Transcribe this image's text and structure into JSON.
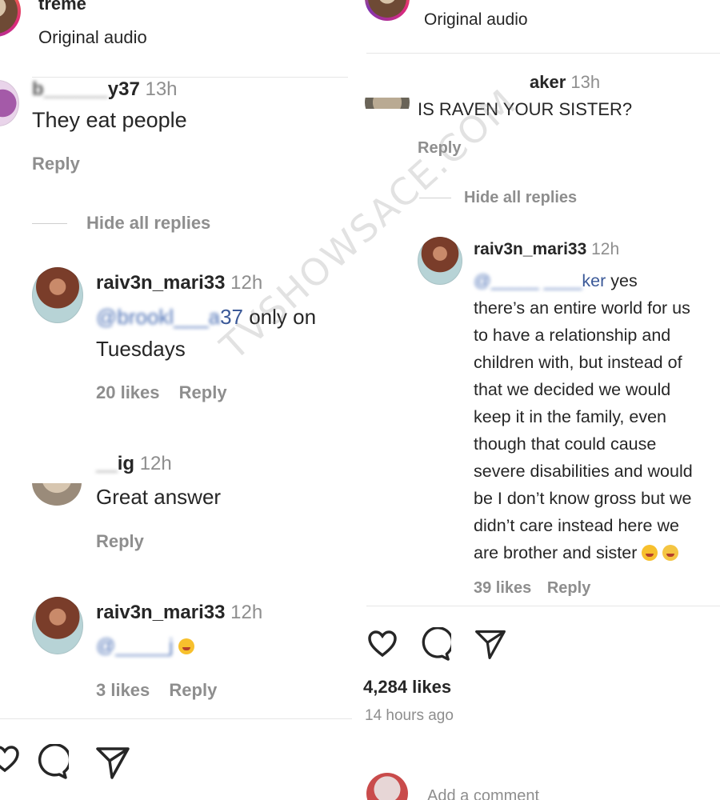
{
  "left": {
    "top_username_fragment": "treme",
    "top_audio": "Original audio",
    "comment1": {
      "username_visible": "y37",
      "time": "13h",
      "text": "They eat people",
      "reply": "Reply"
    },
    "hide_replies": "Hide all replies",
    "reply1": {
      "username": "raiv3n_mari33",
      "time": "12h",
      "mention_visible": "37",
      "text_inline": "only on",
      "text_line2": "Tuesdays",
      "likes": "20 likes",
      "reply": "Reply"
    },
    "reply2": {
      "username_visible": "ig",
      "time": "12h",
      "text": "Great answer",
      "reply": "Reply"
    },
    "reply3": {
      "username": "raiv3n_mari33",
      "time": "12h",
      "likes": "3 likes",
      "reply": "Reply"
    }
  },
  "right": {
    "top_audio": "Original audio",
    "comment1": {
      "username_visible": "aker",
      "time": "13h",
      "text": "IS RAVEN YOUR SISTER?",
      "reply": "Reply"
    },
    "hide_replies": "Hide all replies",
    "reply1": {
      "username": "raiv3n_mari33",
      "time": "12h",
      "mention_visible": "ker",
      "lines": [
        "yes",
        "there’s an entire world for us",
        "to have a relationship and",
        "children with, but instead of",
        "that we decided we would",
        "keep it in the family, even",
        "though that could cause",
        "severe disabilities and would",
        "be I don’t know gross but we",
        "didn’t care instead here we",
        "are brother and sister"
      ],
      "likes": "39 likes",
      "reply": "Reply"
    },
    "likes_total": "4,284 likes",
    "time_ago": "14 hours ago",
    "add_comment": "Add a comment"
  },
  "watermark": "TVSHOWSACE.COM",
  "colors": {
    "text": "#262626",
    "grey": "#8e8e8e",
    "mention": "#3b5998",
    "divider": "#e6e6e6"
  },
  "icons": {
    "like": "heart-icon",
    "comment": "comment-icon",
    "share": "send-icon"
  }
}
